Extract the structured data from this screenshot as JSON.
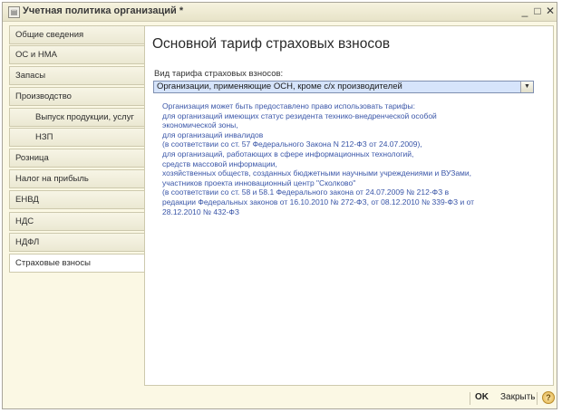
{
  "window": {
    "title": "Учетная политика организаций *",
    "icon": "document-icon",
    "minimize": "_",
    "maximize": "□",
    "close": "✕"
  },
  "sidebar": {
    "active_index": 11,
    "items": [
      {
        "label": "Общие сведения",
        "sub": false
      },
      {
        "label": "ОС и НМА",
        "sub": false
      },
      {
        "label": "Запасы",
        "sub": false
      },
      {
        "label": "Производство",
        "sub": false
      },
      {
        "label": "Выпуск продукции, услуг",
        "sub": true
      },
      {
        "label": "НЗП",
        "sub": true
      },
      {
        "label": "Розница",
        "sub": false
      },
      {
        "label": "Налог на прибыль",
        "sub": false
      },
      {
        "label": "ЕНВД",
        "sub": false
      },
      {
        "label": "НДС",
        "sub": false
      },
      {
        "label": "НДФЛ",
        "sub": false
      },
      {
        "label": "Страховые взносы",
        "sub": false
      }
    ]
  },
  "main": {
    "title": "Основной тариф страховых взносов",
    "tariff_label": "Вид тарифа страховых взносов:",
    "tariff_value": "Организации, применяющие ОСН, кроме с/х производителей",
    "info_lines": [
      "Организация может быть предоставлено право использовать тарифы:",
      "для организаций имеющих статус резидента технико-внедренческой особой",
      "экономической зоны,",
      "для организаций инвалидов",
      "(в соответствии со ст. 57 Федерального Закона  N 212-ФЗ от 24.07.2009),",
      "для организаций, работающих в сфере информационных технологий,",
      "средств массовой информации,",
      "хозяйственных обществ, созданных бюджетными научными учреждениями и ВУЗами,",
      "участников проекта инновационный центр \"Сколково\"",
      "(в соответствии со ст. 58 и 58.1 Федерального закона от 24.07.2009 № 212-ФЗ в",
      "редакции Федеральных законов от 16.10.2010 № 272-ФЗ, от 08.12.2010 № 339-ФЗ и от",
      "28.12.2010 № 432-ФЗ"
    ]
  },
  "footer": {
    "ok": "OK",
    "close": "Закрыть",
    "help": "?"
  },
  "colors": {
    "info_text": "#3a56a8",
    "select_bg": "#d6e4fb",
    "window_bg": "#fbf8e4"
  }
}
